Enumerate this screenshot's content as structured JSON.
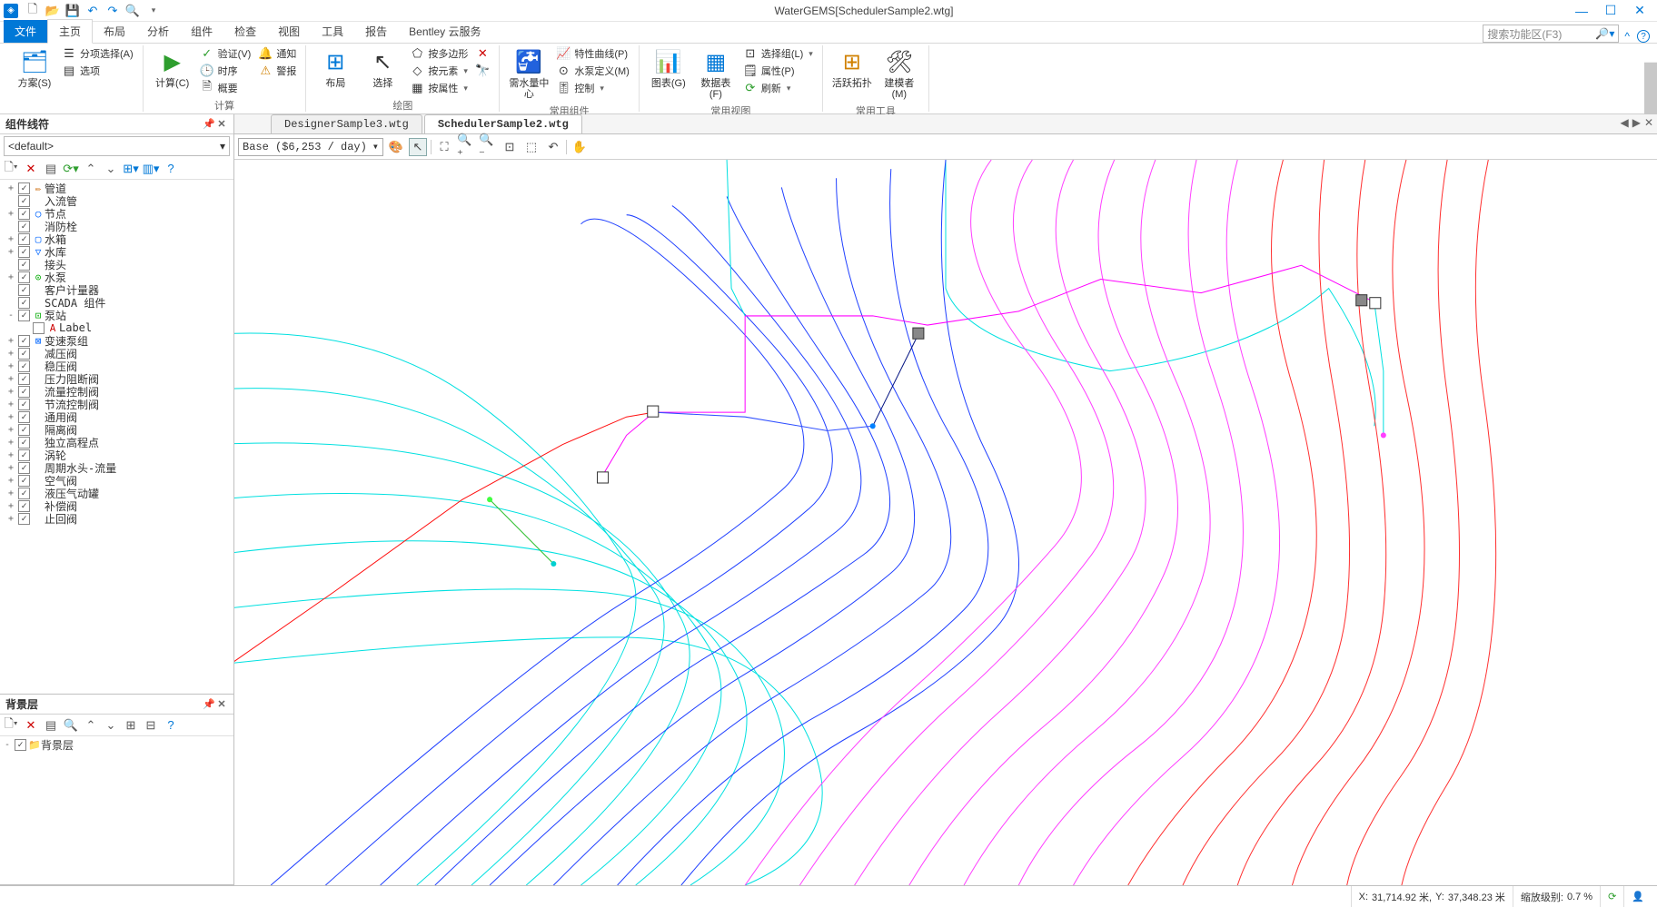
{
  "app": {
    "title": "WaterGEMS[SchedulerSample2.wtg]"
  },
  "qat": {
    "new": "new-doc-icon",
    "open": "open-icon",
    "save": "save-icon",
    "undo": "undo-icon",
    "redo": "redo-icon",
    "print": "print-preview-icon"
  },
  "tabs": {
    "file": "文件",
    "home": "主页",
    "layout": "布局",
    "analyze": "分析",
    "component": "组件",
    "check": "检查",
    "view": "视图",
    "tools": "工具",
    "report": "报告",
    "cloud": "Bentley 云服务",
    "search_placeholder": "搜索功能区(F3)"
  },
  "ribbon": {
    "g1": {
      "scheme": "方案(S)",
      "select_all": "分项选择(A)",
      "options": "选项",
      "label": ""
    },
    "g2": {
      "compute": "计算(C)",
      "verify": "验证(V)",
      "sequence": "时序",
      "summary": "概要",
      "notify": "通知",
      "alarm": "警报",
      "label": "计算"
    },
    "g3": {
      "layout": "布局",
      "select": "选择",
      "by_poly": "按多边形",
      "by_elem": "按元素",
      "by_attr": "按属性",
      "label": "绘图"
    },
    "g4": {
      "demand_center": "需水量中心",
      "curves": "特性曲线(P)",
      "pump_def": "水泵定义(M)",
      "control": "控制",
      "label": "常用组件"
    },
    "g5": {
      "chart": "图表(G)",
      "table": "数据表(F)",
      "sel_set": "选择组(L)",
      "props": "属性(P)",
      "refresh": "刷新",
      "label": "常用视图"
    },
    "g6": {
      "active_topo": "活跃拓扑",
      "modeler": "建模者(M)",
      "label": "常用工具"
    }
  },
  "panels": {
    "components": {
      "title": "组件线符",
      "default": "<default>",
      "tree": [
        {
          "exp": "+",
          "chk": true,
          "ico": "✏",
          "lbl": "管道",
          "ind": 0,
          "col": "#cc6600"
        },
        {
          "exp": " ",
          "chk": true,
          "ico": "",
          "lbl": "入流管",
          "ind": 0
        },
        {
          "exp": "+",
          "chk": true,
          "ico": "○",
          "lbl": "节点",
          "ind": 0,
          "col": "#0066ff"
        },
        {
          "exp": " ",
          "chk": true,
          "ico": "",
          "lbl": "消防栓",
          "ind": 0
        },
        {
          "exp": "+",
          "chk": true,
          "ico": "▢",
          "lbl": "水箱",
          "ind": 0,
          "col": "#0066ff"
        },
        {
          "exp": "+",
          "chk": true,
          "ico": "▽",
          "lbl": "水库",
          "ind": 0,
          "col": "#0066ff"
        },
        {
          "exp": " ",
          "chk": true,
          "ico": "",
          "lbl": "接头",
          "ind": 0
        },
        {
          "exp": "+",
          "chk": true,
          "ico": "⊙",
          "lbl": "水泵",
          "ind": 0,
          "col": "#00aa00"
        },
        {
          "exp": " ",
          "chk": true,
          "ico": "",
          "lbl": "客户计量器",
          "ind": 0
        },
        {
          "exp": " ",
          "chk": true,
          "ico": "",
          "lbl": "SCADA 组件",
          "ind": 0
        },
        {
          "exp": "-",
          "chk": true,
          "ico": "⊡",
          "lbl": "泵站",
          "ind": 0,
          "col": "#00aa00"
        },
        {
          "exp": " ",
          "chk": false,
          "ico": "A",
          "lbl": "Label",
          "ind": 1,
          "col": "#cc0000"
        },
        {
          "exp": "+",
          "chk": true,
          "ico": "⊠",
          "lbl": "变速泵组",
          "ind": 0,
          "col": "#0066ff"
        },
        {
          "exp": "+",
          "chk": true,
          "ico": "",
          "lbl": "减压阀",
          "ind": 0
        },
        {
          "exp": "+",
          "chk": true,
          "ico": "",
          "lbl": "稳压阀",
          "ind": 0
        },
        {
          "exp": "+",
          "chk": true,
          "ico": "",
          "lbl": "压力阻断阀",
          "ind": 0
        },
        {
          "exp": "+",
          "chk": true,
          "ico": "",
          "lbl": "流量控制阀",
          "ind": 0
        },
        {
          "exp": "+",
          "chk": true,
          "ico": "",
          "lbl": "节流控制阀",
          "ind": 0
        },
        {
          "exp": "+",
          "chk": true,
          "ico": "",
          "lbl": "通用阀",
          "ind": 0
        },
        {
          "exp": "+",
          "chk": true,
          "ico": "",
          "lbl": "隔离阀",
          "ind": 0
        },
        {
          "exp": "+",
          "chk": true,
          "ico": "",
          "lbl": "独立高程点",
          "ind": 0
        },
        {
          "exp": "+",
          "chk": true,
          "ico": "",
          "lbl": "涡轮",
          "ind": 0
        },
        {
          "exp": "+",
          "chk": true,
          "ico": "",
          "lbl": "周期水头-流量",
          "ind": 0
        },
        {
          "exp": "+",
          "chk": true,
          "ico": "",
          "lbl": "空气阀",
          "ind": 0
        },
        {
          "exp": "+",
          "chk": true,
          "ico": "",
          "lbl": "液压气动罐",
          "ind": 0
        },
        {
          "exp": "+",
          "chk": true,
          "ico": "",
          "lbl": "补偿阀",
          "ind": 0
        },
        {
          "exp": "+",
          "chk": true,
          "ico": "",
          "lbl": "止回阀",
          "ind": 0
        }
      ]
    },
    "background": {
      "title": "背景层",
      "item": "背景层"
    }
  },
  "docs": {
    "tab1": "DesignerSample3.wtg",
    "tab2": "SchedulerSample2.wtg"
  },
  "viewtb": {
    "scenario": "Base ($6,253 / day)"
  },
  "status": {
    "coords_label": "X:",
    "x": "31,714.92 米,",
    "y_label": "Y:",
    "y": "37,348.23 米",
    "zoom_label": "缩放级别:",
    "zoom": "0.7 %"
  }
}
